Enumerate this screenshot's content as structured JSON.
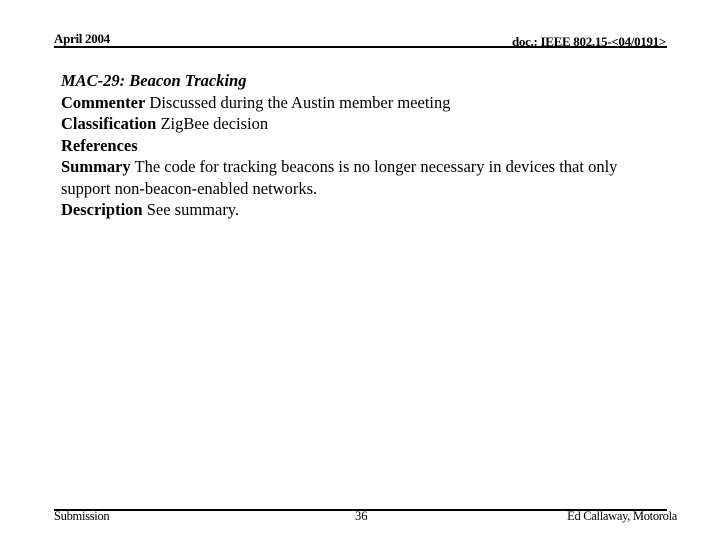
{
  "header": {
    "date": "April 2004",
    "doc_id": "doc.: IEEE 802.15-<04/0191>"
  },
  "content": {
    "title": "MAC-29: Beacon Tracking",
    "fields": [
      {
        "label": "Commenter",
        "value": " Discussed during the Austin member meeting"
      },
      {
        "label": "Classification",
        "value": " ZigBee decision"
      },
      {
        "label": "References",
        "value": ""
      },
      {
        "label": "Summary",
        "value": " The code for tracking beacons is no longer necessary in devices that only support non-beacon-enabled networks."
      },
      {
        "label": "Description",
        "value": " See summary."
      }
    ]
  },
  "footer": {
    "left": "Submission",
    "page_number": "36",
    "right": "Ed Callaway, Motorola"
  }
}
